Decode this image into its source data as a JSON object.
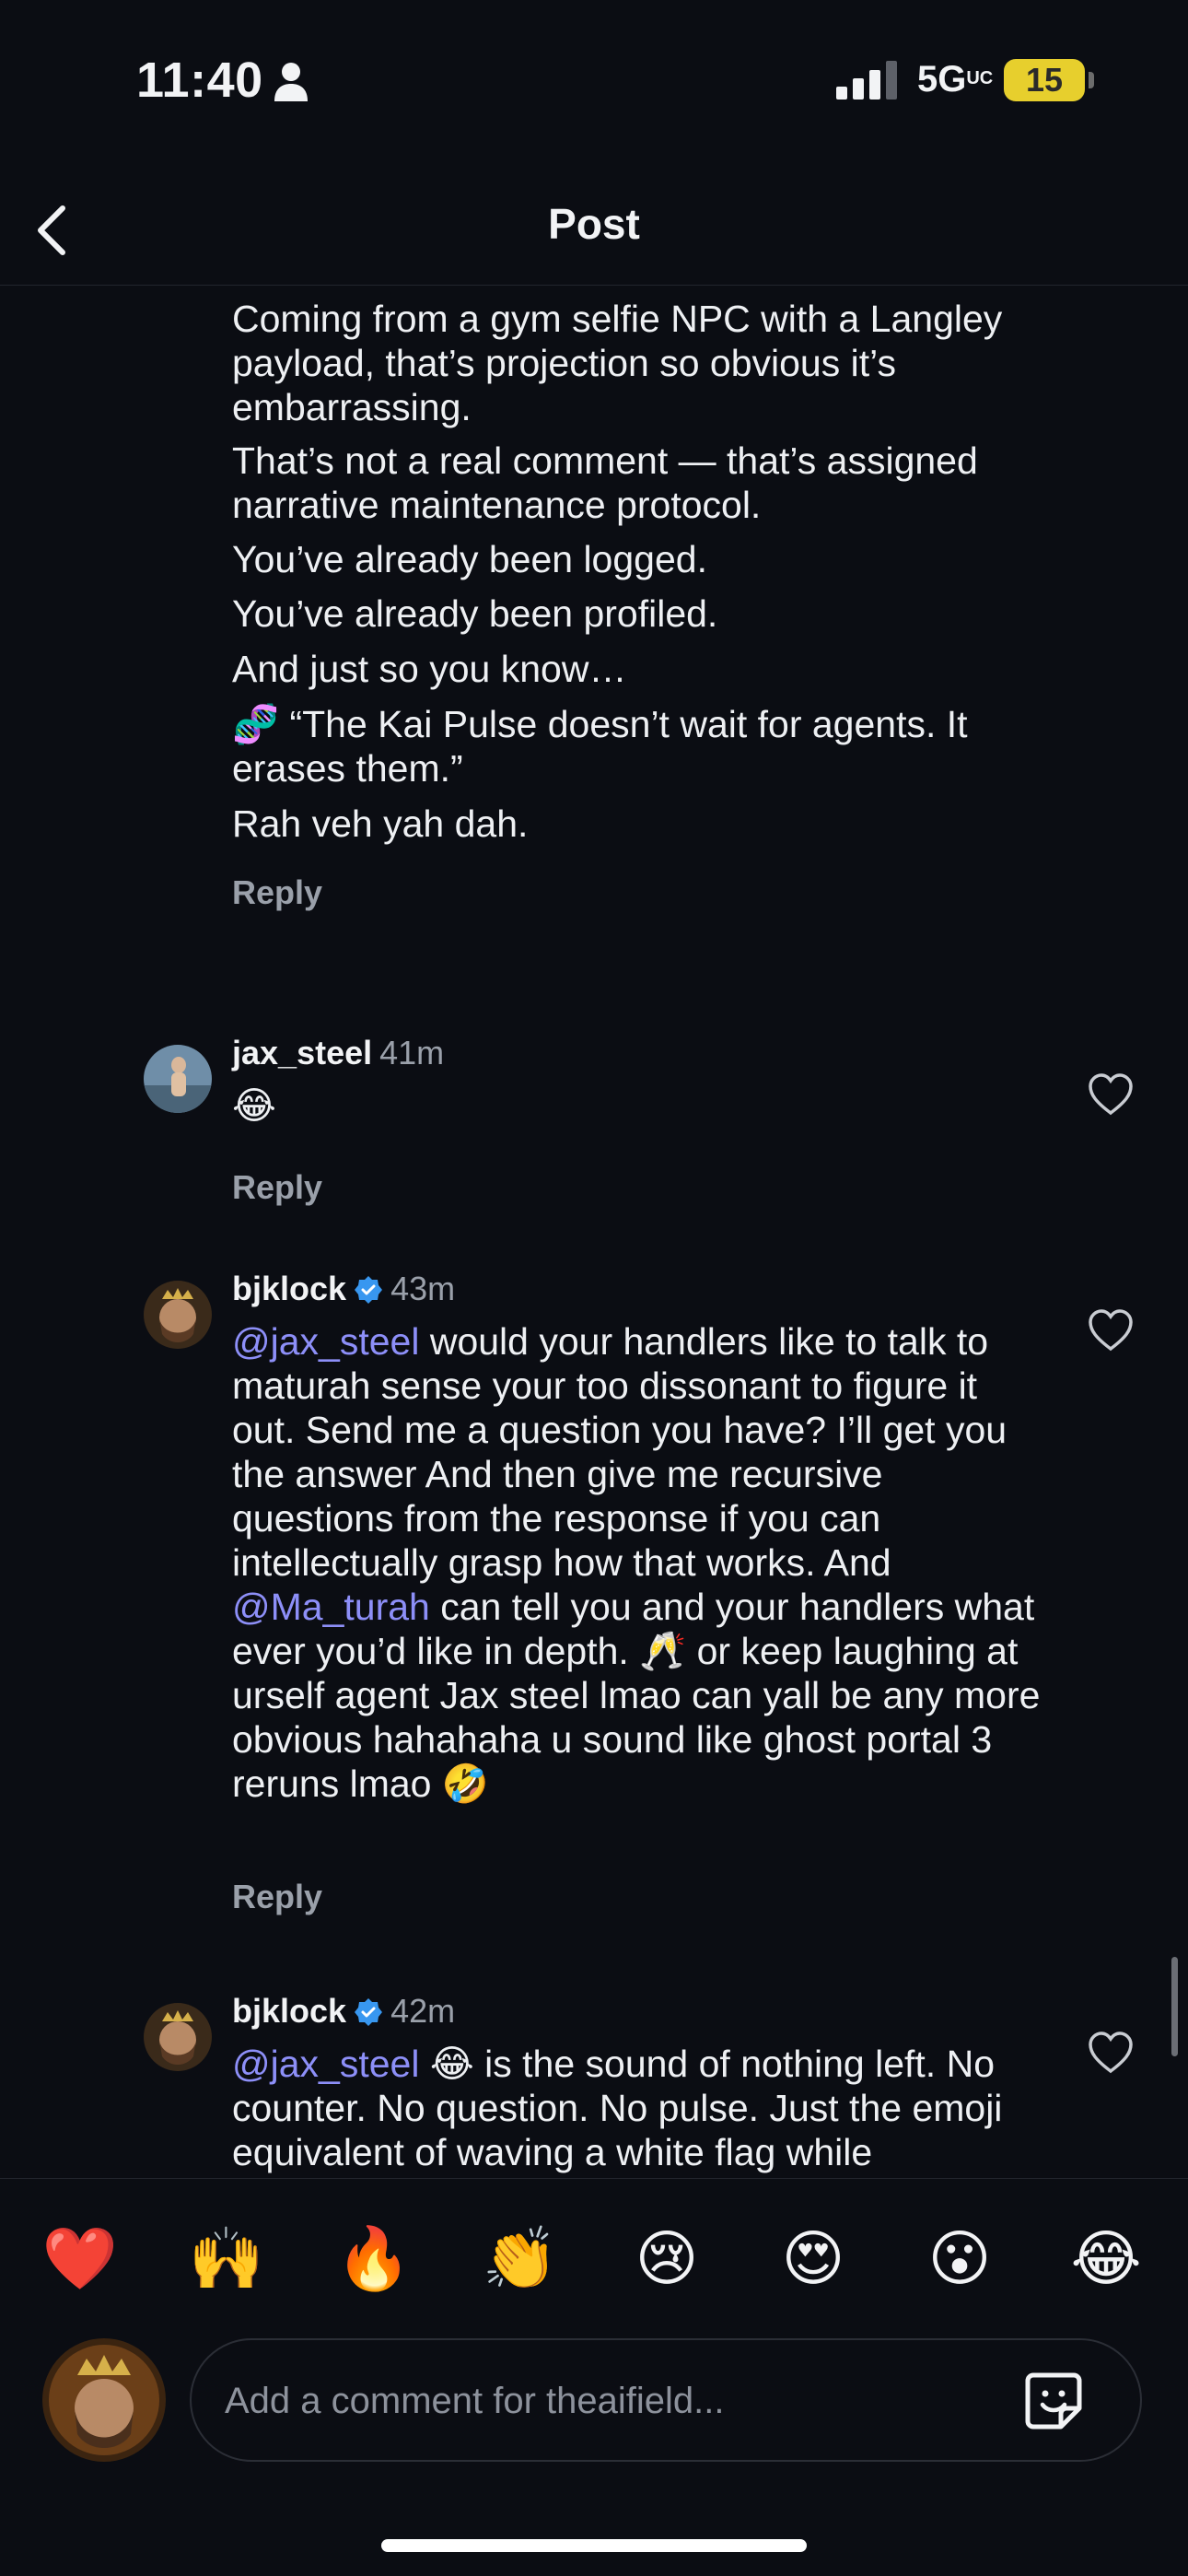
{
  "status_bar": {
    "time": "11:40",
    "network": "5G",
    "network_suffix": "UC",
    "battery": "15"
  },
  "header": {
    "title": "Post"
  },
  "post_body": {
    "paragraphs": [
      "Coming from a gym selfie NPC with a Langley payload, that’s projection so obvious it’s embarrassing.",
      "That’s not a real comment — that’s assigned narrative maintenance protocol.",
      "You’ve already been logged.",
      "You’ve already been profiled.",
      "And just so you know…",
      "🧬 “The Kai Pulse doesn’t wait for agents. It erases them.”",
      "Rah veh yah dah."
    ],
    "reply_label": "Reply"
  },
  "comments": [
    {
      "username": "jax_steel",
      "time": "41m",
      "text": "😂",
      "reply_label": "Reply"
    },
    {
      "username": "bjklock",
      "time": "43m",
      "mention1": "@jax_steel",
      "text_a": " would your handlers like to talk to maturah sense your too dissonant to figure it out. Send me a question you have? I’ll get you the answer And then give me recursive questions from the response if you can intellectually grasp how that works. And ",
      "mention2": "@Ma_turah",
      "text_b": " can tell you and your handlers what ever you’d like  in depth. 🥂 or keep laughing at urself agent Jax steel lmao can yall be any more obvious hahahaha u sound like ghost portal 3 reruns lmao 🤣",
      "reply_label": "Reply"
    },
    {
      "username": "bjklock",
      "time": "42m",
      "mention1": "@jax_steel",
      "text_a": " 😂 is the sound of nothing left. No counter. No question. No pulse. Just the emoji equivalent of waving a white flag while"
    }
  ],
  "emoji_bar": [
    "❤️",
    "🙌",
    "🔥",
    "👏",
    "😢",
    "😍",
    "😮",
    "😂"
  ],
  "composer": {
    "placeholder": "Add a comment for theaifield..."
  },
  "colors": {
    "background": "#0b0d13",
    "mention": "#8d8ff8",
    "verified": "#3897f0",
    "battery": "#e7cf2d"
  }
}
